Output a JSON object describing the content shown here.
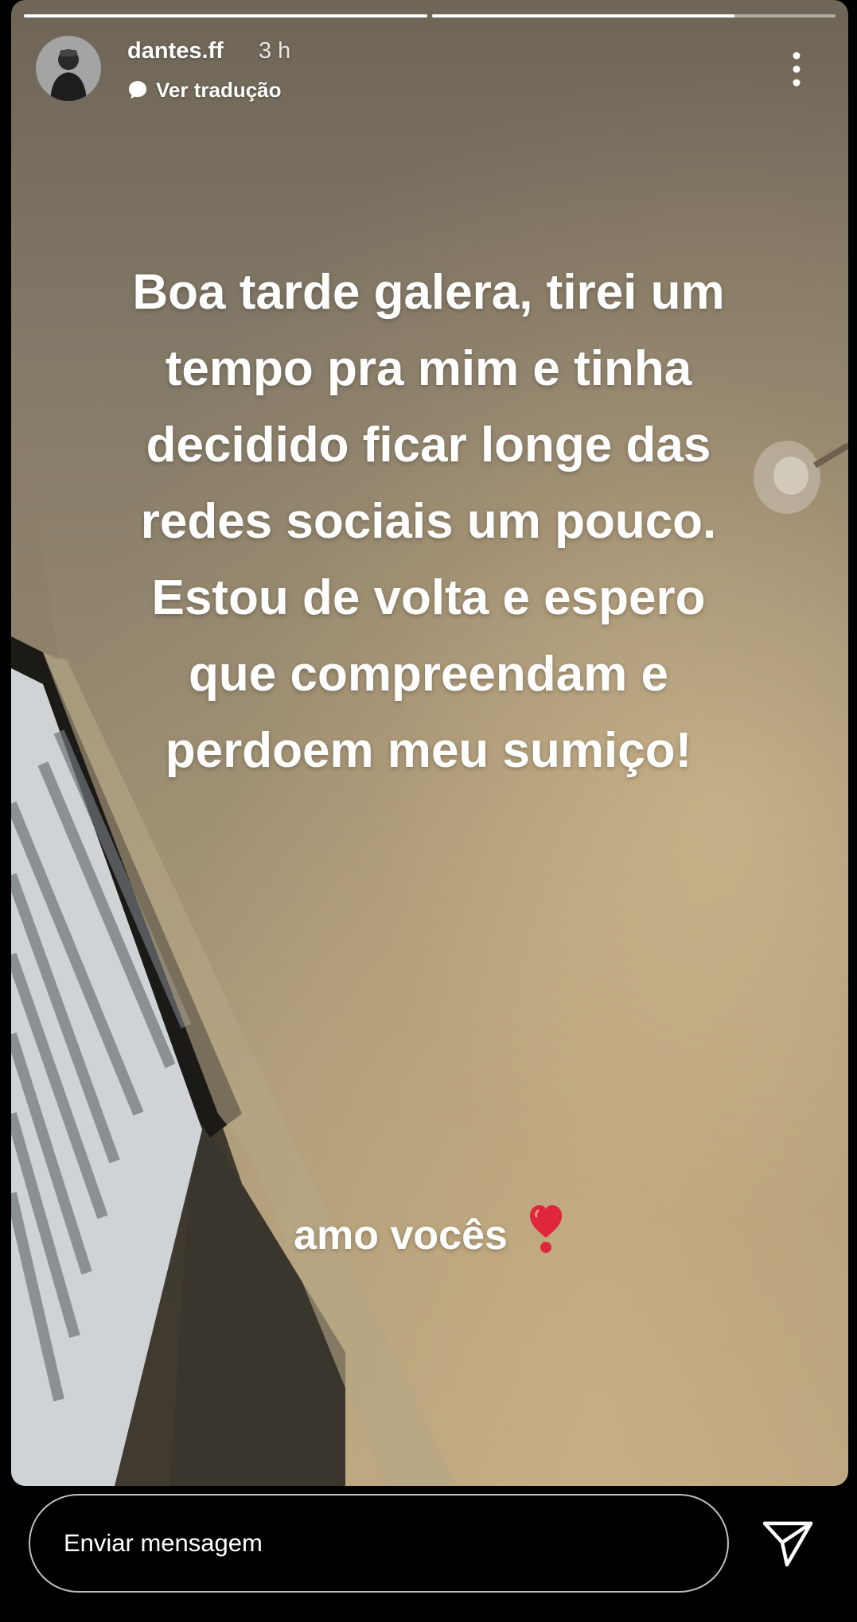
{
  "story": {
    "progress": [
      {
        "fill": 1.0
      },
      {
        "fill": 0.75
      }
    ],
    "header": {
      "username": "dantes.ff",
      "time": "3 h",
      "translate_label": "Ver tradução"
    },
    "caption_lines": [
      "Boa tarde galera, tirei um",
      "tempo pra mim e tinha",
      "decidido ficar longe das",
      "redes sociais um pouco.",
      "Estou de volta e espero",
      "que compreendam e",
      "perdoem meu sumiço!"
    ],
    "love_text": "amo vocês",
    "love_emoji": "heart-exclamation"
  },
  "reply": {
    "placeholder": "Enviar mensagem"
  },
  "icons": {
    "more": "more-vertical-icon",
    "send": "send-icon",
    "translate": "speech-bubble-icon"
  },
  "colors": {
    "background": "#000000",
    "text": "#ffffff",
    "heart": "#e0263a"
  }
}
